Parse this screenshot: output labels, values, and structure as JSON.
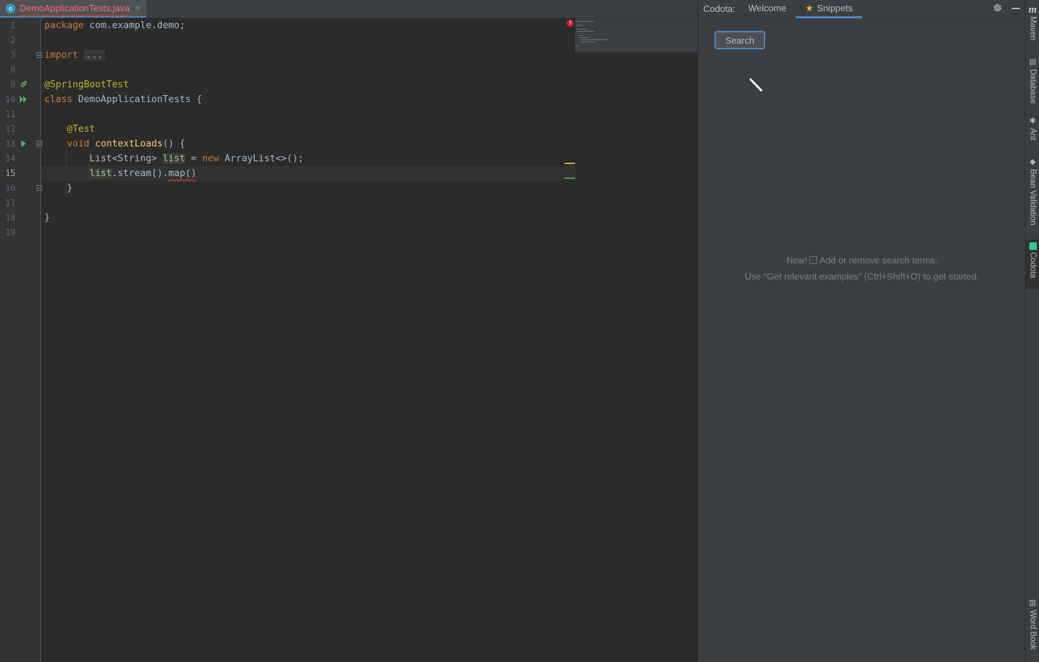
{
  "editor": {
    "tab": {
      "filename": "DemoApplicationTests.java",
      "icon": "c",
      "close": "×"
    },
    "current_line": 15,
    "line_numbers": [
      "1",
      "2",
      "3",
      "8",
      "9",
      "10",
      "11",
      "12",
      "13",
      "14",
      "15",
      "16",
      "17",
      "18",
      "19"
    ],
    "code": {
      "l1_kw": "package",
      "l1_rest": " com.example.demo;",
      "l3_kw": "import",
      "l3_fold": "...",
      "l9_ann": "@SpringBootTest",
      "l10_kw": "class",
      "l10_rest": " DemoApplicationTests {",
      "l12_ann": "@Test",
      "l13_kw": "void",
      "l13_fn": "contextLoads",
      "l13_rest": "() {",
      "l14_type": "List<String> ",
      "l14_var": "list",
      "l14_eq": " = ",
      "l14_kw": "new",
      "l14_rest": " ArrayList<>();",
      "l15_var": "list",
      "l15_mid": ".stream().",
      "l15_err": "map()",
      "l16": "}",
      "l18": "}"
    },
    "error_marker": "!"
  },
  "codota": {
    "title": "Codota:",
    "tabs": [
      "Welcome",
      "Snippets"
    ],
    "active_tab": "Snippets",
    "search_label": "Search",
    "message_line1_a": "New!",
    "message_line1_b": "Add or remove search terms.",
    "message_line2": "Use \"Get relevant examples\" (Ctrl+Shift+O) to get started.",
    "icons": [
      "gear-icon",
      "minimize-icon"
    ]
  },
  "tool_strip": {
    "maven_icon": "m",
    "items": [
      "Maven",
      "Database",
      "Ant",
      "Bean Validation",
      "Codota",
      "Word Book"
    ],
    "active": "Codota"
  },
  "colors": {
    "keyword": "#cc7832",
    "annotation": "#bbb529",
    "function": "#ffc66d",
    "text": "#a9b7c6",
    "accent": "#4a88c7",
    "error": "#bc3f3c"
  }
}
